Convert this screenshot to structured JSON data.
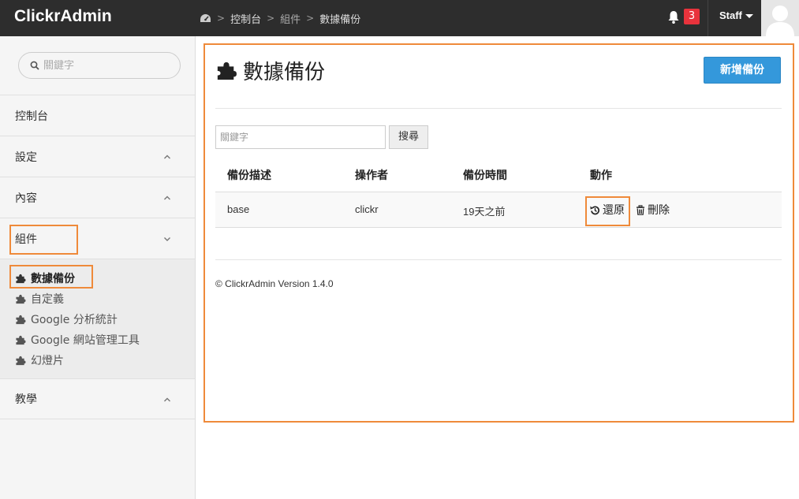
{
  "app": {
    "brand": "ClickrAdmin"
  },
  "breadcrumb": {
    "items": [
      "控制台",
      "組件",
      "數據備份"
    ]
  },
  "header": {
    "notification_count": "3",
    "user_label": "Staff"
  },
  "sidebar": {
    "search_placeholder": "關鍵字",
    "items": [
      {
        "label": "控制台"
      },
      {
        "label": "設定"
      },
      {
        "label": "內容"
      },
      {
        "label": "組件"
      },
      {
        "label": "教學"
      }
    ],
    "sub_items": [
      {
        "label": "數據備份"
      },
      {
        "label": "自定義"
      },
      {
        "label": "Google 分析統計"
      },
      {
        "label": "Google 網站管理工具"
      },
      {
        "label": "幻燈片"
      }
    ]
  },
  "page": {
    "title": "數據備份",
    "add_button": "新增備份",
    "filter_placeholder": "關鍵字",
    "search_button": "搜尋",
    "columns": [
      "備份描述",
      "操作者",
      "備份時間",
      "動作"
    ],
    "rows": [
      {
        "description": "base",
        "operator": "clickr",
        "time": "19天之前",
        "restore": "還原",
        "delete": "刪除"
      }
    ],
    "footer": "© ClickrAdmin Version 1.4.0"
  },
  "colors": {
    "accent": "#3498db",
    "highlight": "#ef8a3a",
    "badge": "#e8333c",
    "topbar": "#2d2d2d"
  }
}
